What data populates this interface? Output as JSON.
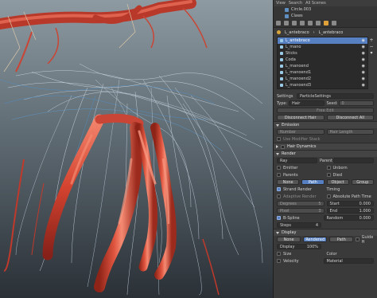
{
  "outliner": {
    "header": [
      "View",
      "Search",
      "All Scenes"
    ],
    "rows": [
      "Circle.003",
      "Claws"
    ]
  },
  "crumb": {
    "object": "L_antebraco",
    "psys": "L_antebraco"
  },
  "psys_list": [
    "L_antebraco",
    "L_mano",
    "Sticks",
    "Coda",
    "L_manoend",
    "L_manoend1",
    "L_manoend2",
    "L_manoend3"
  ],
  "settings": {
    "label": "Settings",
    "value": "ParticleSettings",
    "type_label": "Type:",
    "type_value": "Hair",
    "seed_label": "Seed:",
    "seed_value": "0",
    "free_edit": "Free Edit",
    "disconnect_hair": "Disconnect Hair",
    "disconnect_all": "Disconnect All"
  },
  "emission": {
    "title": "Emission",
    "number": "Number",
    "hair_length": "Hair Length",
    "use_modifier_stack": "Use Modifier Stack"
  },
  "hair_dynamics": {
    "title": "Hair Dynamics"
  },
  "render": {
    "title": "Render",
    "ray": "Ray",
    "parent": "Parent",
    "emitter": "Emitter",
    "unborn": "Unborn",
    "parents": "Parents",
    "died": "Died",
    "modes": [
      "None",
      "Path",
      "Object",
      "Group"
    ],
    "strand_render": "Strand Render",
    "timing": "Timing",
    "adaptive_render": "Adaptive Render",
    "absolute_path_time": "Absolute Path Time",
    "degrees_label": "Degrees",
    "degrees_value": "5",
    "start_label": "Start",
    "start_value": "0.000",
    "pixel_label": "Pixel",
    "pixel_value": "3",
    "end_label": "End",
    "end_value": "1.000",
    "bspline": "B-Spline",
    "random_label": "Random",
    "random_value": "0.000",
    "steps_label": "Steps",
    "steps_value": "4"
  },
  "display": {
    "title": "Display",
    "modes": [
      "None",
      "Rendered",
      "Path"
    ],
    "guide_hair": "Guide H",
    "display_label": "Display",
    "display_value": "100%",
    "size": "Size",
    "color_label": "Color",
    "velocity": "Velocity",
    "color_value": "Material"
  },
  "colors": {
    "accent": "#5680c2",
    "vessel": "#c8402f",
    "vessel_highlight": "#f07a62",
    "hair_blue": "#4a8fc9",
    "hair_white": "#c9d6e4"
  }
}
